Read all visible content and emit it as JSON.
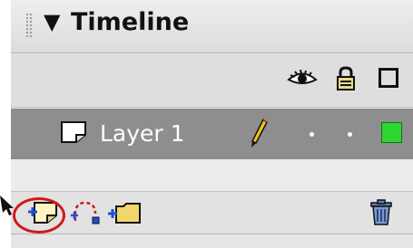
{
  "panel": {
    "title": "Timeline",
    "collapse_icon": "triangle-down-icon",
    "grip_icon": "drag-grip-icon"
  },
  "columns": {
    "icons": [
      "eye-icon",
      "lock-icon",
      "outline-icon"
    ]
  },
  "layers": [
    {
      "name": "Layer 1",
      "type_icon": "layer-page-icon",
      "edit_icon": "pencil-icon",
      "visible": true,
      "locked": false,
      "outline_color": "#2fd52f"
    }
  ],
  "toolbar": {
    "buttons": [
      "insert-layer-icon",
      "add-motion-guide-icon",
      "insert-layer-folder-icon",
      "delete-layer-icon"
    ]
  },
  "annotation": {
    "highlight_color": "#d11919",
    "highlighted_button": "insert-layer-icon"
  },
  "colors": {
    "selected_row": "#8e8e8e",
    "panel_bg": "#e6e6e6",
    "layer_swatch": "#2fd52f"
  }
}
